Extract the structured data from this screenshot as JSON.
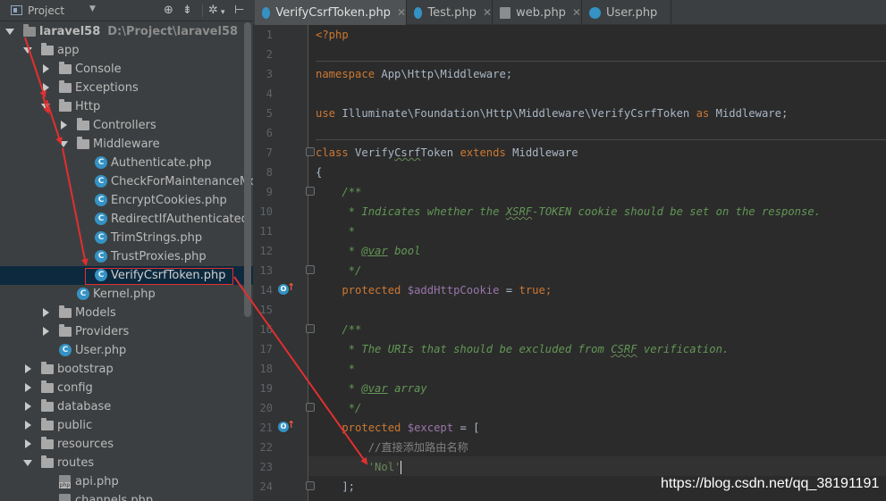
{
  "project_panel": {
    "title": "Project",
    "toolbar_icons": [
      "target-icon",
      "collapse-icon",
      "gear-icon",
      "hide-icon"
    ],
    "tree": [
      {
        "label": "laravel58",
        "path": "D:\\Project\\laravel58",
        "type": "folder",
        "expanded": true
      },
      {
        "label": "app",
        "type": "folder",
        "expanded": true
      },
      {
        "label": "Console",
        "type": "folder",
        "expanded": false
      },
      {
        "label": "Exceptions",
        "type": "folder",
        "expanded": false
      },
      {
        "label": "Http",
        "type": "folder",
        "expanded": true
      },
      {
        "label": "Controllers",
        "type": "folder",
        "expanded": false
      },
      {
        "label": "Middleware",
        "type": "folder",
        "expanded": true
      },
      {
        "label": "Authenticate.php",
        "type": "class"
      },
      {
        "label": "CheckForMaintenanceMode.php",
        "type": "class"
      },
      {
        "label": "EncryptCookies.php",
        "type": "class"
      },
      {
        "label": "RedirectIfAuthenticated.php",
        "type": "class"
      },
      {
        "label": "TrimStrings.php",
        "type": "class"
      },
      {
        "label": "TrustProxies.php",
        "type": "class"
      },
      {
        "label": "VerifyCsrfToken.php",
        "type": "class",
        "selected": true
      },
      {
        "label": "Kernel.php",
        "type": "class"
      },
      {
        "label": "Models",
        "type": "folder",
        "expanded": false
      },
      {
        "label": "Providers",
        "type": "folder",
        "expanded": false
      },
      {
        "label": "User.php",
        "type": "class"
      },
      {
        "label": "bootstrap",
        "type": "folder",
        "expanded": false
      },
      {
        "label": "config",
        "type": "folder",
        "expanded": false
      },
      {
        "label": "database",
        "type": "folder",
        "expanded": false
      },
      {
        "label": "public",
        "type": "folder",
        "expanded": false
      },
      {
        "label": "resources",
        "type": "folder",
        "expanded": false
      },
      {
        "label": "routes",
        "type": "folder",
        "expanded": true
      },
      {
        "label": "api.php",
        "type": "php"
      },
      {
        "label": "channels.php",
        "type": "php"
      }
    ]
  },
  "editor": {
    "tabs": [
      {
        "label": "VerifyCsrfToken.php",
        "icon": "class-icon",
        "active": true
      },
      {
        "label": "Test.php",
        "icon": "class-icon",
        "active": false
      },
      {
        "label": "web.php",
        "icon": "php-file-icon",
        "active": false
      },
      {
        "label": "User.php",
        "icon": "class-icon",
        "active": false
      }
    ],
    "line_numbers": [
      "1",
      "2",
      "3",
      "4",
      "5",
      "6",
      "7",
      "8",
      "9",
      "10",
      "11",
      "12",
      "13",
      "14",
      "15",
      "16",
      "17",
      "18",
      "19",
      "20",
      "21",
      "22",
      "23",
      "24"
    ],
    "code": {
      "l1": "<?php",
      "l3_kw": "namespace",
      "l3_rest": " App\\Http\\Middleware;",
      "l5_kw": "use",
      "l5_mid": " Illuminate\\Foundation\\Http\\Middleware\\VerifyCsrfToken ",
      "l5_as": "as",
      "l5_end": " Middleware;",
      "l7_kw": "class",
      "l7_a": " Verify",
      "l7_b": "Csrf",
      "l7_c": "Token ",
      "l7_ext": "extends",
      "l7_end": " Middleware",
      "l8": "{",
      "l9": "    /**",
      "l10_a": "     * Indicates whether the ",
      "l10_b": "XSRF",
      "l10_c": "-TOKEN cookie should be set on the response.",
      "l11": "     *",
      "l12_a": "     * ",
      "l12_tag": "@var",
      "l12_b": " bool",
      "l13": "     */",
      "l14_kw": "    protected ",
      "l14_var": "$addHttpCookie",
      "l14_eq": " = ",
      "l14_true": "true",
      "l14_end": ";",
      "l16": "    /**",
      "l17_a": "     * The URIs that should be excluded from ",
      "l17_b": "CSRF",
      "l17_c": " verification.",
      "l18": "     *",
      "l19_a": "     * ",
      "l19_tag": "@var",
      "l19_b": " array",
      "l20": "     */",
      "l21_kw": "    protected ",
      "l21_var": "$except",
      "l21_end": " = [",
      "l22": "        //直接添加路由名称",
      "l23_a": "        ",
      "l23_str": "'Nol'",
      "l24": "    ];"
    }
  },
  "watermark": "https://blog.csdn.net/qq_38191191",
  "colors": {
    "panel_bg": "#3c3f41",
    "editor_bg": "#2b2b2b",
    "keyword": "#cc7832",
    "comment": "#629755",
    "variable": "#9876aa",
    "annotation_red": "#e03030"
  }
}
